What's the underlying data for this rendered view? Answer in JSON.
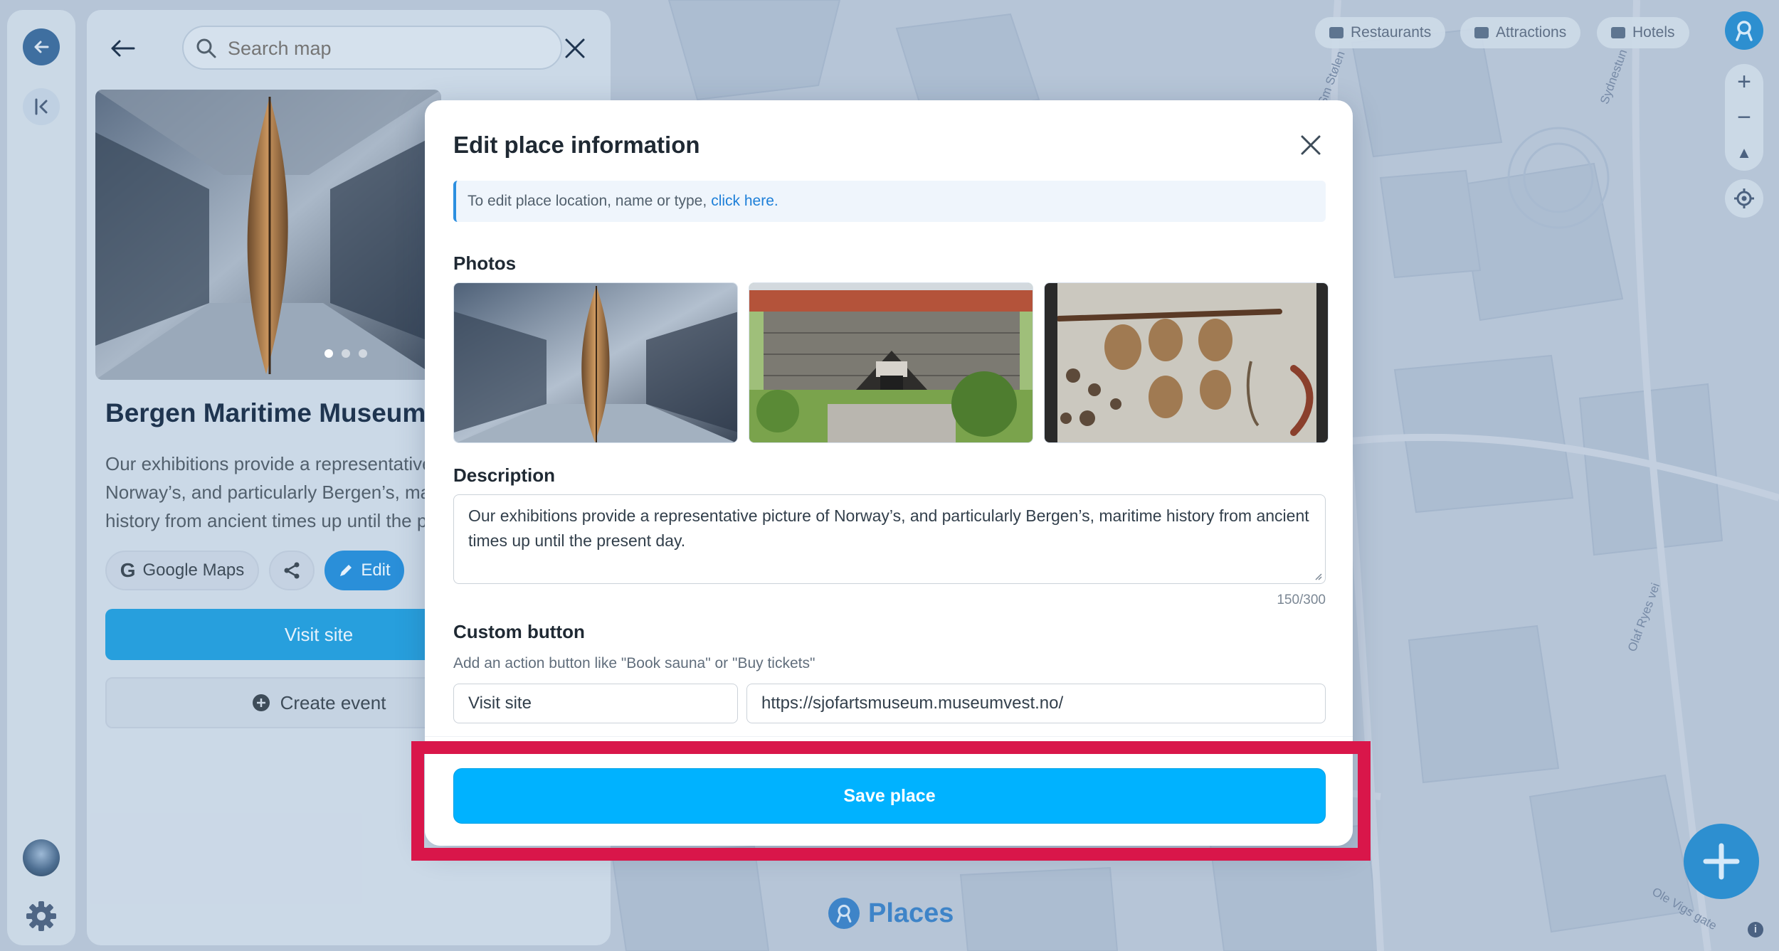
{
  "app": {
    "brand_name": "Places"
  },
  "search": {
    "placeholder": "Search map"
  },
  "place": {
    "title": "Bergen Maritime Museum",
    "description": "Our exhibitions provide a representative picture of Norway’s, and particularly Bergen’s, maritime history from ancient times up until the present day.",
    "buttons": {
      "google_maps": "Google Maps",
      "edit": "Edit",
      "visit_site": "Visit site",
      "create_event": "Create event"
    },
    "carousel": {
      "count": 3,
      "active": 1
    }
  },
  "map_chips": [
    "Restaurants",
    "Attractions",
    "Hotels"
  ],
  "map_labels": [
    "Sydnestun",
    "Olaf Ryes vei",
    "Ole Vigs gate",
    "Sm Stølen"
  ],
  "modal": {
    "title": "Edit place information",
    "notice_text": "To edit place location, name or type,",
    "notice_link": "click here.",
    "photos_label": "Photos",
    "description_label": "Description",
    "description_value": "Our exhibitions provide a representative picture of Norway’s, and particularly Bergen’s, maritime history from ancient times up until the present day.",
    "description_counter": "150/300",
    "custom_button_label": "Custom button",
    "custom_button_hint": "Add an action button like \"Book sauna\" or \"Buy tickets\"",
    "custom_button_text": "Visit site",
    "custom_button_url": "https://sjofartsmuseum.museumvest.no/",
    "save_label": "Save place"
  },
  "colors": {
    "accent": "#00b2ff",
    "highlight": "#d9164a",
    "brand": "#3e84c8"
  }
}
